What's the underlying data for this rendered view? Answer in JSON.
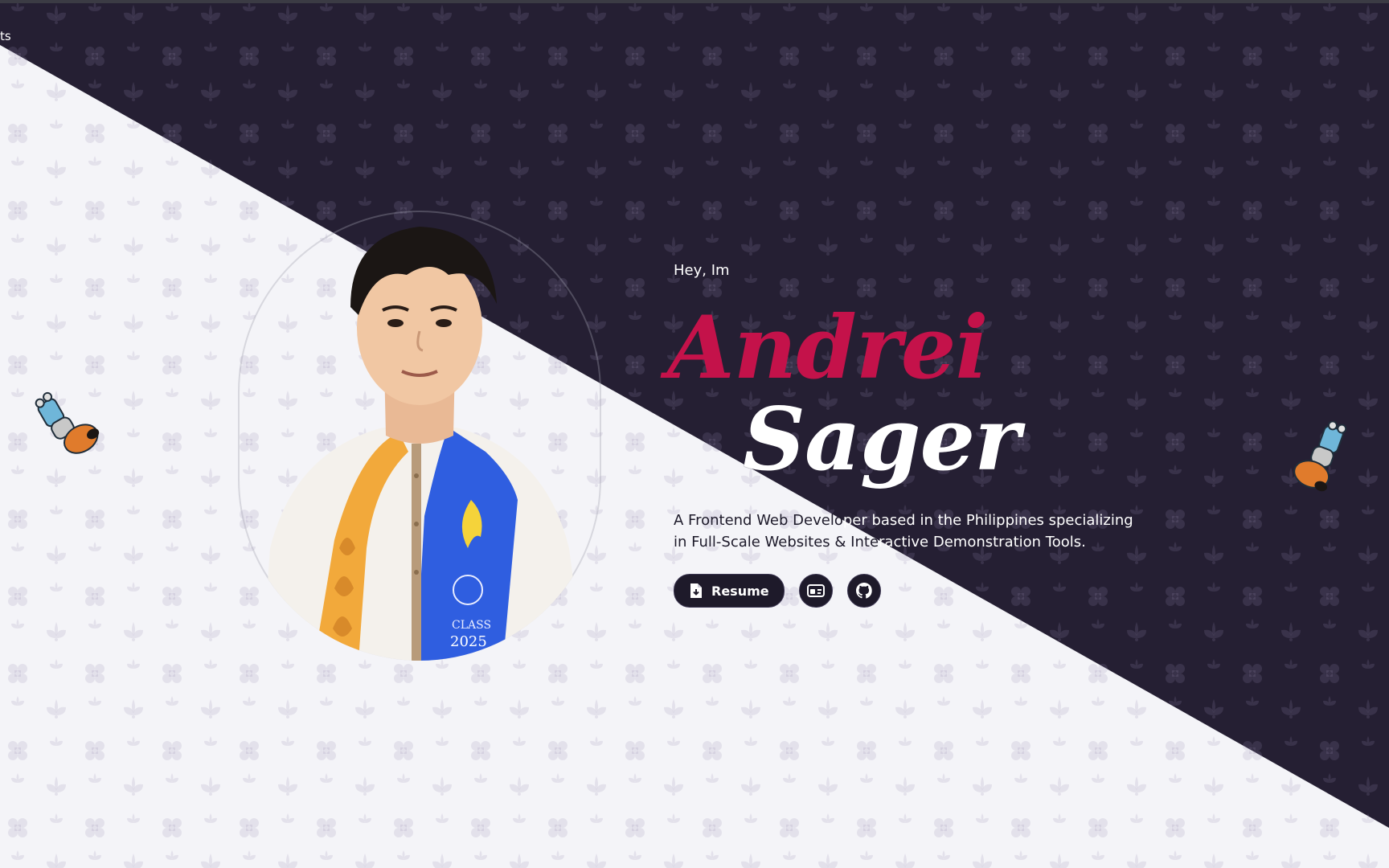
{
  "nav": {
    "fragment": "ts"
  },
  "hero": {
    "greeting": "Hey, Im",
    "first_name": "Andrei",
    "last_name": "Sager",
    "bio_line1_dark": "A Frontend Web Develo",
    "bio_line1_light": "per based in the Philippines specializing",
    "bio_line2_dark": "in Full-Scale Websites & Inte",
    "bio_line2_light": "ractive Demonstration Tools.",
    "resume_label": "Resume"
  },
  "portrait": {
    "sash_text_class": "CLASS",
    "sash_text_year": "2025"
  },
  "colors": {
    "dark_bg": "#251f33",
    "light_bg": "#f4f4f8",
    "accent": "#c4124a"
  },
  "icons": [
    "file-download-icon",
    "id-card-icon",
    "github-icon"
  ]
}
